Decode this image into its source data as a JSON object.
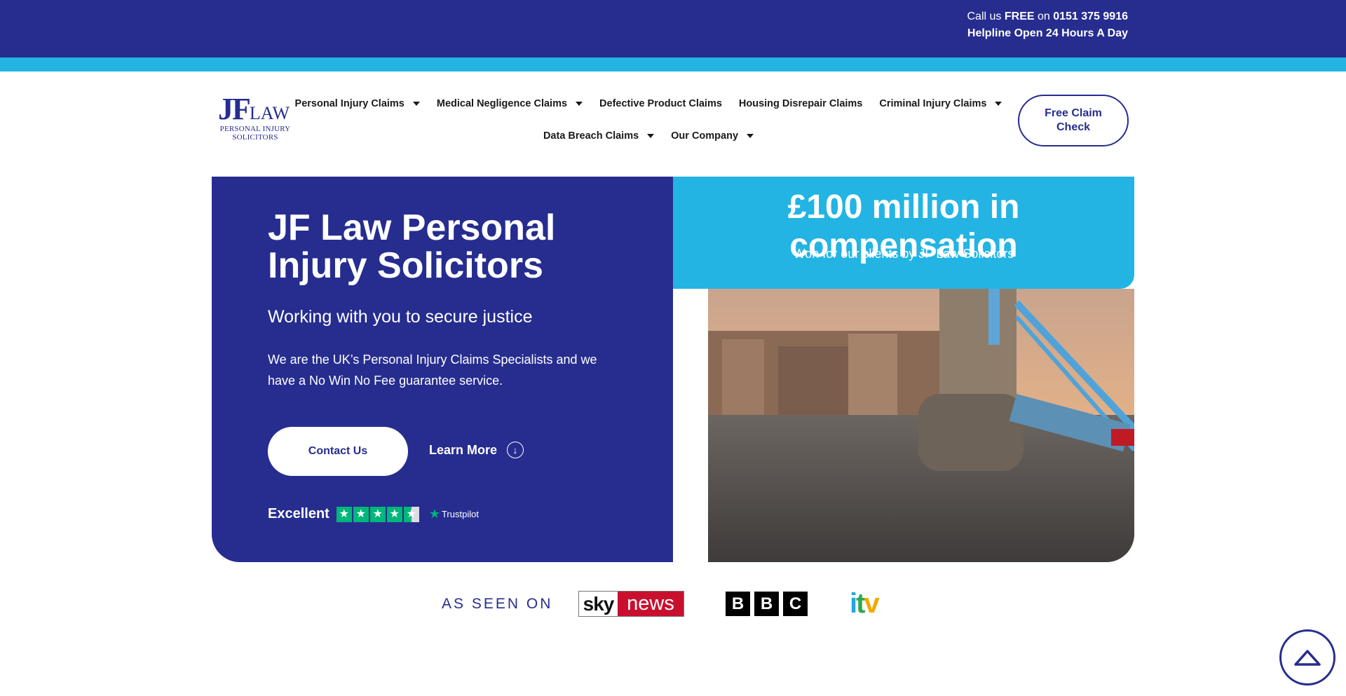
{
  "topbar": {
    "call_prefix": "Call us ",
    "call_free": "FREE",
    "call_on": " on ",
    "phone": "0151 375 9916",
    "helpline": "Helpline Open 24 Hours A Day"
  },
  "logo": {
    "jf": "JF",
    "law": "LAW",
    "sub_line1": "PERSONAL INJURY",
    "sub_line2": "SOLICITORS"
  },
  "nav": {
    "row1": [
      {
        "label": "Personal Injury Claims",
        "dropdown": true
      },
      {
        "label": "Medical Negligence Claims",
        "dropdown": true
      },
      {
        "label": "Defective Product Claims",
        "dropdown": false
      },
      {
        "label": "Housing Disrepair Claims",
        "dropdown": false
      },
      {
        "label": "Criminal Injury Claims",
        "dropdown": true
      }
    ],
    "row2": [
      {
        "label": "Data Breach Claims",
        "dropdown": true
      },
      {
        "label": "Our Company",
        "dropdown": true
      }
    ],
    "cta": "Free Claim Check"
  },
  "hero": {
    "title": "JF Law Personal Injury Solicitors",
    "subtitle": "Working with you to secure justice",
    "description": "We are the UK’s Personal Injury Claims Specialists and we have a No Win No Fee guarantee service.",
    "contact_label": "Contact Us",
    "learn_more_label": "Learn More",
    "trust_label": "Excellent",
    "trust_brand": "Trustpilot",
    "trust_rating": 4.5
  },
  "stat": {
    "headline": "£100 million in compensation",
    "caption": "Won for our clients by JF Law Solicitors"
  },
  "as_seen_on": {
    "label": "AS SEEN ON",
    "sky_a": "sky",
    "sky_b": "news",
    "bbc": [
      "B",
      "B",
      "C"
    ],
    "itv": "itv"
  },
  "colors": {
    "navy": "#262d8f",
    "cyan": "#23b4e3",
    "trustpilot_green": "#00b67a",
    "sky_red": "#c8102e"
  },
  "icons": {
    "learn_more": "arrow-down-circle-icon",
    "scroll_top": "chevron-up-icon",
    "trustpilot": "star-icon"
  }
}
